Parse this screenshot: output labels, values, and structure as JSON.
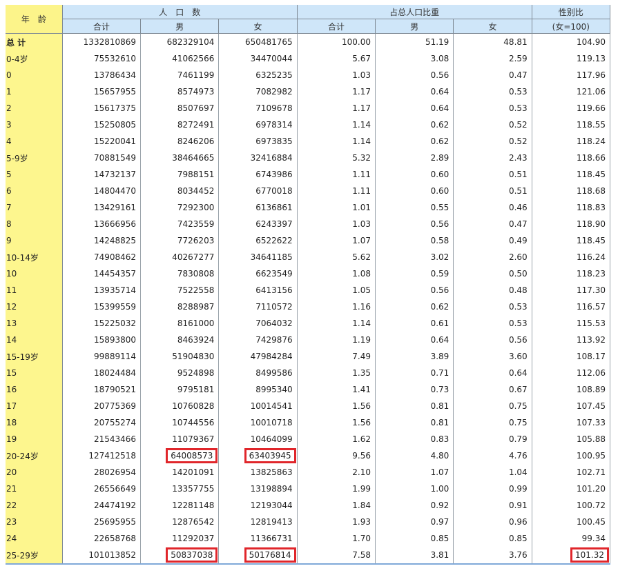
{
  "header": {
    "age": "年　龄",
    "population": "人　口　数",
    "share": "占总人口比重",
    "sex_ratio": "性别比",
    "sex_ratio_note": "(女=100)",
    "total": "合计",
    "male": "男",
    "female": "女"
  },
  "rows": [
    {
      "age": "总 计",
      "total": "1332810869",
      "male": "682329104",
      "female": "650481765",
      "pct_total": "100.00",
      "pct_male": "51.19",
      "pct_female": "48.81",
      "sex_ratio": "104.90",
      "bold": true
    },
    {
      "age": "0-4岁",
      "total": "75532610",
      "male": "41062566",
      "female": "34470044",
      "pct_total": "5.67",
      "pct_male": "3.08",
      "pct_female": "2.59",
      "sex_ratio": "119.13"
    },
    {
      "age": "0",
      "total": "13786434",
      "male": "7461199",
      "female": "6325235",
      "pct_total": "1.03",
      "pct_male": "0.56",
      "pct_female": "0.47",
      "sex_ratio": "117.96"
    },
    {
      "age": "1",
      "total": "15657955",
      "male": "8574973",
      "female": "7082982",
      "pct_total": "1.17",
      "pct_male": "0.64",
      "pct_female": "0.53",
      "sex_ratio": "121.06"
    },
    {
      "age": "2",
      "total": "15617375",
      "male": "8507697",
      "female": "7109678",
      "pct_total": "1.17",
      "pct_male": "0.64",
      "pct_female": "0.53",
      "sex_ratio": "119.66"
    },
    {
      "age": "3",
      "total": "15250805",
      "male": "8272491",
      "female": "6978314",
      "pct_total": "1.14",
      "pct_male": "0.62",
      "pct_female": "0.52",
      "sex_ratio": "118.55"
    },
    {
      "age": "4",
      "total": "15220041",
      "male": "8246206",
      "female": "6973835",
      "pct_total": "1.14",
      "pct_male": "0.62",
      "pct_female": "0.52",
      "sex_ratio": "118.24"
    },
    {
      "age": "5-9岁",
      "total": "70881549",
      "male": "38464665",
      "female": "32416884",
      "pct_total": "5.32",
      "pct_male": "2.89",
      "pct_female": "2.43",
      "sex_ratio": "118.66"
    },
    {
      "age": "5",
      "total": "14732137",
      "male": "7988151",
      "female": "6743986",
      "pct_total": "1.11",
      "pct_male": "0.60",
      "pct_female": "0.51",
      "sex_ratio": "118.45"
    },
    {
      "age": "6",
      "total": "14804470",
      "male": "8034452",
      "female": "6770018",
      "pct_total": "1.11",
      "pct_male": "0.60",
      "pct_female": "0.51",
      "sex_ratio": "118.68"
    },
    {
      "age": "7",
      "total": "13429161",
      "male": "7292300",
      "female": "6136861",
      "pct_total": "1.01",
      "pct_male": "0.55",
      "pct_female": "0.46",
      "sex_ratio": "118.83"
    },
    {
      "age": "8",
      "total": "13666956",
      "male": "7423559",
      "female": "6243397",
      "pct_total": "1.03",
      "pct_male": "0.56",
      "pct_female": "0.47",
      "sex_ratio": "118.90"
    },
    {
      "age": "9",
      "total": "14248825",
      "male": "7726203",
      "female": "6522622",
      "pct_total": "1.07",
      "pct_male": "0.58",
      "pct_female": "0.49",
      "sex_ratio": "118.45"
    },
    {
      "age": "10-14岁",
      "total": "74908462",
      "male": "40267277",
      "female": "34641185",
      "pct_total": "5.62",
      "pct_male": "3.02",
      "pct_female": "2.60",
      "sex_ratio": "116.24"
    },
    {
      "age": "10",
      "total": "14454357",
      "male": "7830808",
      "female": "6623549",
      "pct_total": "1.08",
      "pct_male": "0.59",
      "pct_female": "0.50",
      "sex_ratio": "118.23"
    },
    {
      "age": "11",
      "total": "13935714",
      "male": "7522558",
      "female": "6413156",
      "pct_total": "1.05",
      "pct_male": "0.56",
      "pct_female": "0.48",
      "sex_ratio": "117.30"
    },
    {
      "age": "12",
      "total": "15399559",
      "male": "8288987",
      "female": "7110572",
      "pct_total": "1.16",
      "pct_male": "0.62",
      "pct_female": "0.53",
      "sex_ratio": "116.57"
    },
    {
      "age": "13",
      "total": "15225032",
      "male": "8161000",
      "female": "7064032",
      "pct_total": "1.14",
      "pct_male": "0.61",
      "pct_female": "0.53",
      "sex_ratio": "115.53"
    },
    {
      "age": "14",
      "total": "15893800",
      "male": "8463924",
      "female": "7429876",
      "pct_total": "1.19",
      "pct_male": "0.64",
      "pct_female": "0.56",
      "sex_ratio": "113.92"
    },
    {
      "age": "15-19岁",
      "total": "99889114",
      "male": "51904830",
      "female": "47984284",
      "pct_total": "7.49",
      "pct_male": "3.89",
      "pct_female": "3.60",
      "sex_ratio": "108.17"
    },
    {
      "age": "15",
      "total": "18024484",
      "male": "9524898",
      "female": "8499586",
      "pct_total": "1.35",
      "pct_male": "0.71",
      "pct_female": "0.64",
      "sex_ratio": "112.06"
    },
    {
      "age": "16",
      "total": "18790521",
      "male": "9795181",
      "female": "8995340",
      "pct_total": "1.41",
      "pct_male": "0.73",
      "pct_female": "0.67",
      "sex_ratio": "108.89"
    },
    {
      "age": "17",
      "total": "20775369",
      "male": "10760828",
      "female": "10014541",
      "pct_total": "1.56",
      "pct_male": "0.81",
      "pct_female": "0.75",
      "sex_ratio": "107.45"
    },
    {
      "age": "18",
      "total": "20755274",
      "male": "10744556",
      "female": "10010718",
      "pct_total": "1.56",
      "pct_male": "0.81",
      "pct_female": "0.75",
      "sex_ratio": "107.33"
    },
    {
      "age": "19",
      "total": "21543466",
      "male": "11079367",
      "female": "10464099",
      "pct_total": "1.62",
      "pct_male": "0.83",
      "pct_female": "0.79",
      "sex_ratio": "105.88"
    },
    {
      "age": "20-24岁",
      "total": "127412518",
      "male": "64008573",
      "female": "63403945",
      "pct_total": "9.56",
      "pct_male": "4.80",
      "pct_female": "4.76",
      "sex_ratio": "100.95",
      "hl": [
        "male",
        "female"
      ]
    },
    {
      "age": "20",
      "total": "28026954",
      "male": "14201091",
      "female": "13825863",
      "pct_total": "2.10",
      "pct_male": "1.07",
      "pct_female": "1.04",
      "sex_ratio": "102.71"
    },
    {
      "age": "21",
      "total": "26556649",
      "male": "13357755",
      "female": "13198894",
      "pct_total": "1.99",
      "pct_male": "1.00",
      "pct_female": "0.99",
      "sex_ratio": "101.20"
    },
    {
      "age": "22",
      "total": "24474192",
      "male": "12281148",
      "female": "12193044",
      "pct_total": "1.84",
      "pct_male": "0.92",
      "pct_female": "0.91",
      "sex_ratio": "100.72"
    },
    {
      "age": "23",
      "total": "25695955",
      "male": "12876542",
      "female": "12819413",
      "pct_total": "1.93",
      "pct_male": "0.97",
      "pct_female": "0.96",
      "sex_ratio": "100.45"
    },
    {
      "age": "24",
      "total": "22658768",
      "male": "11292037",
      "female": "11366731",
      "pct_total": "1.70",
      "pct_male": "0.85",
      "pct_female": "0.85",
      "sex_ratio": "99.34"
    },
    {
      "age": "25-29岁",
      "total": "101013852",
      "male": "50837038",
      "female": "50176814",
      "pct_total": "7.58",
      "pct_male": "3.81",
      "pct_female": "3.76",
      "sex_ratio": "101.32",
      "hl": [
        "male",
        "female",
        "sex_ratio"
      ]
    }
  ],
  "colors": {
    "header_bg": "#cfe6f9",
    "age_col_bg": "#fdf68e",
    "highlight_box": "#e0262b"
  }
}
